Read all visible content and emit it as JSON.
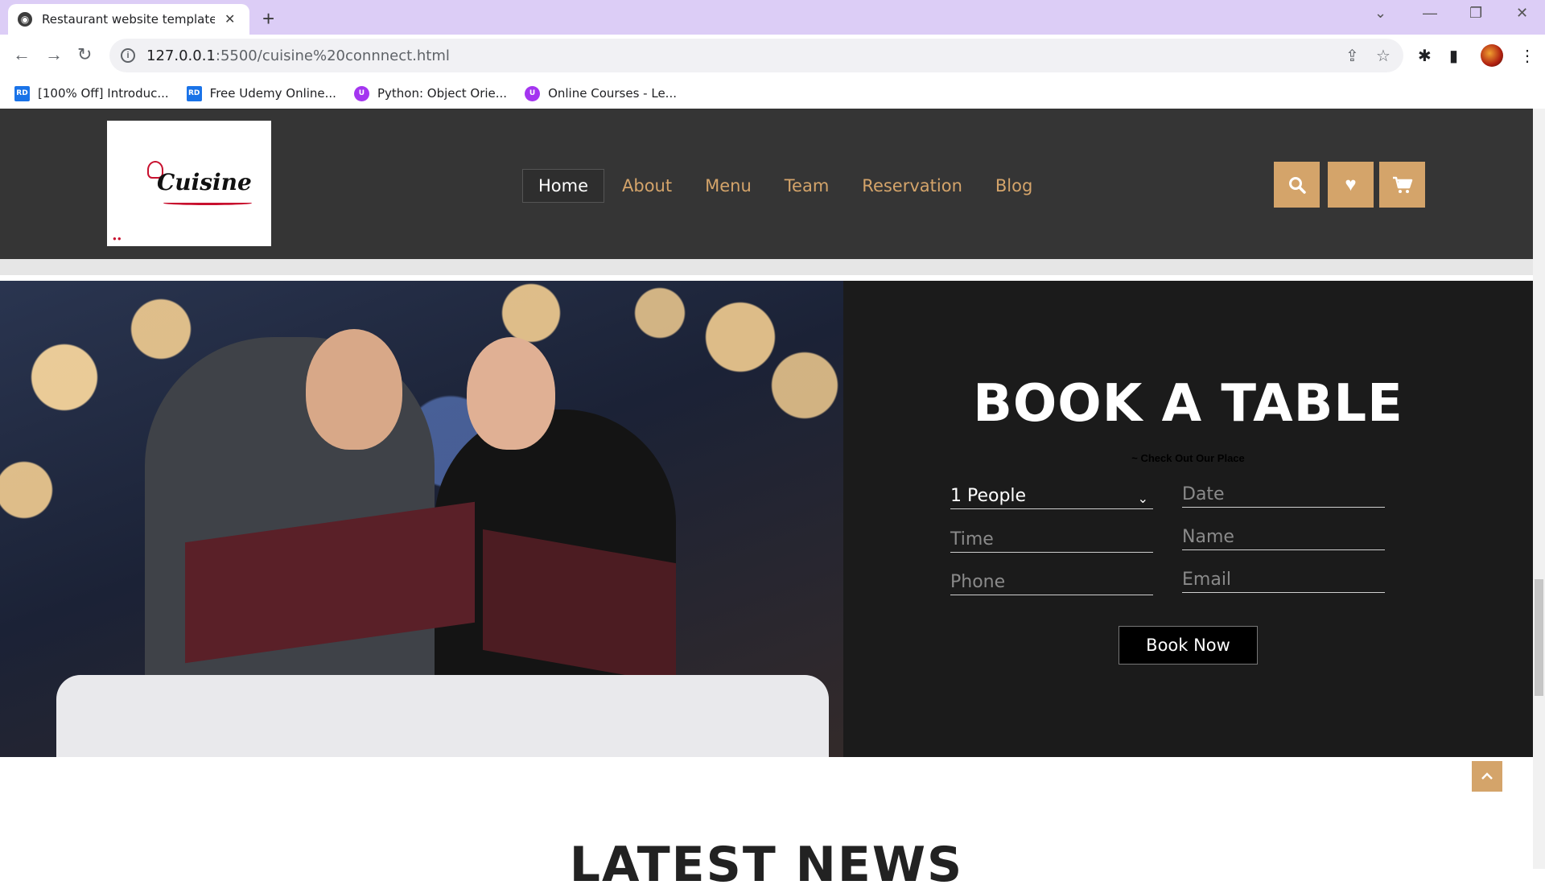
{
  "browser": {
    "tab_title": "Restaurant website template wit",
    "url_host": "127.0.0.1",
    "url_path": ":5500/cuisine%20connnect.html",
    "bookmarks": [
      {
        "icon": "RD",
        "label": "[100% Off] Introduc..."
      },
      {
        "icon": "RD",
        "label": "Free Udemy Online..."
      },
      {
        "icon": "U",
        "label": "Python: Object Orie..."
      },
      {
        "icon": "U",
        "label": "Online Courses - Le..."
      }
    ]
  },
  "site": {
    "logo_text": "Cuisine",
    "nav": [
      "Home",
      "About",
      "Menu",
      "Team",
      "Reservation",
      "Blog"
    ],
    "accent_color": "#d4a46a"
  },
  "booking": {
    "title": "BOOK A TABLE",
    "subtitle": "~ Check Out Our Place",
    "people_value": "1 People",
    "date_placeholder": "Date",
    "time_placeholder": "Time",
    "name_placeholder": "Name",
    "phone_placeholder": "Phone",
    "email_placeholder": "Email",
    "button_label": "Book Now"
  },
  "news": {
    "title": "LATEST NEWS"
  }
}
